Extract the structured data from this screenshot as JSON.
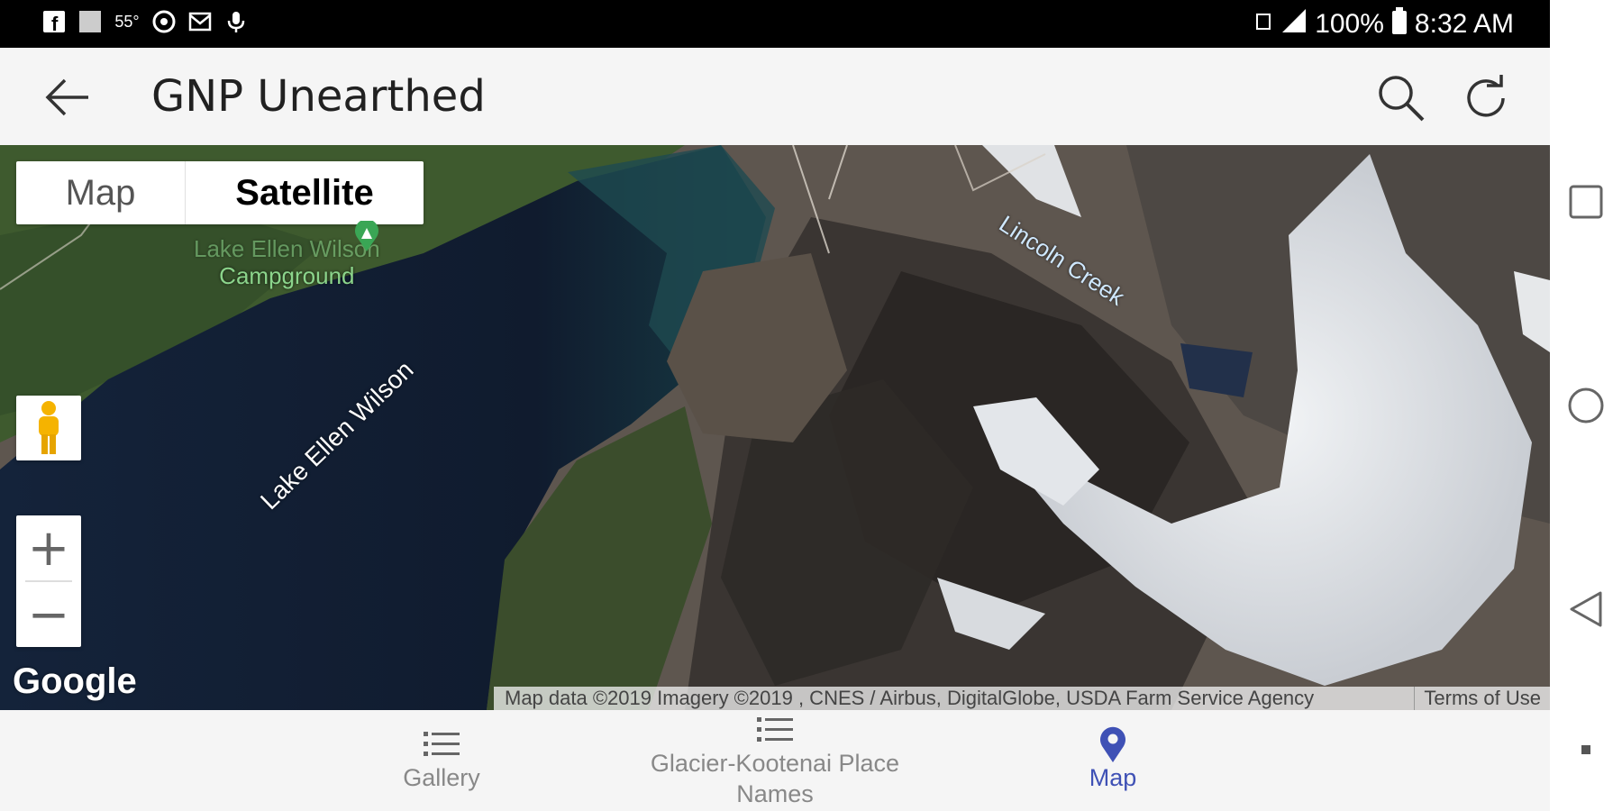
{
  "status_bar": {
    "left_icons": [
      "facebook-icon",
      "image-icon",
      "weather-icon",
      "vpn-icon",
      "mail-icon",
      "mic-icon"
    ],
    "temperature": "55°",
    "battery_percent": "100%",
    "time": "8:32 AM"
  },
  "app_bar": {
    "title": "GNP Unearthed"
  },
  "map": {
    "type_options": [
      "Map",
      "Satellite"
    ],
    "selected_type": "Satellite",
    "labels": {
      "campground_line1": "Lake Ellen Wilson",
      "campground_line2": "Campground",
      "lake": "Lake Ellen Wilson",
      "creek": "Lincoln Creek"
    },
    "zoom_in": "+",
    "zoom_out": "−",
    "google_logo": "Google",
    "attribution": "Map data ©2019 Imagery ©2019 , CNES / Airbus, DigitalGlobe, USDA Farm Service Agency",
    "terms": "Terms of Use"
  },
  "bottom_nav": {
    "items": [
      {
        "label": "Gallery",
        "icon": "list-icon"
      },
      {
        "label": "Glacier-Kootenai Place Names",
        "icon": "list-icon"
      },
      {
        "label": "Map",
        "icon": "map-pin-icon"
      }
    ],
    "active_index": 2
  },
  "colors": {
    "active": "#3f51b5",
    "inactive": "#888888",
    "bar_background": "#f5f5f5"
  }
}
